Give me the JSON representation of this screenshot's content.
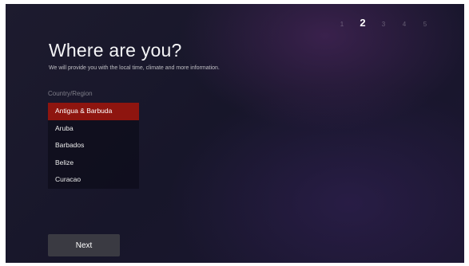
{
  "steps": {
    "items": [
      "1",
      "2",
      "3",
      "4",
      "5"
    ],
    "current": "2"
  },
  "page": {
    "title": "Where are you?",
    "subtitle": "We will provide you with the local time, climate and more information."
  },
  "region": {
    "label": "Country/Region",
    "options": [
      "Antigua & Barbuda",
      "Aruba",
      "Barbados",
      "Belize",
      "Curacao"
    ],
    "selected": "Antigua & Barbuda"
  },
  "actions": {
    "next_label": "Next"
  },
  "colors": {
    "selection": "#8e150f",
    "button": "#3a3a42",
    "background": "#1b1a2e"
  }
}
